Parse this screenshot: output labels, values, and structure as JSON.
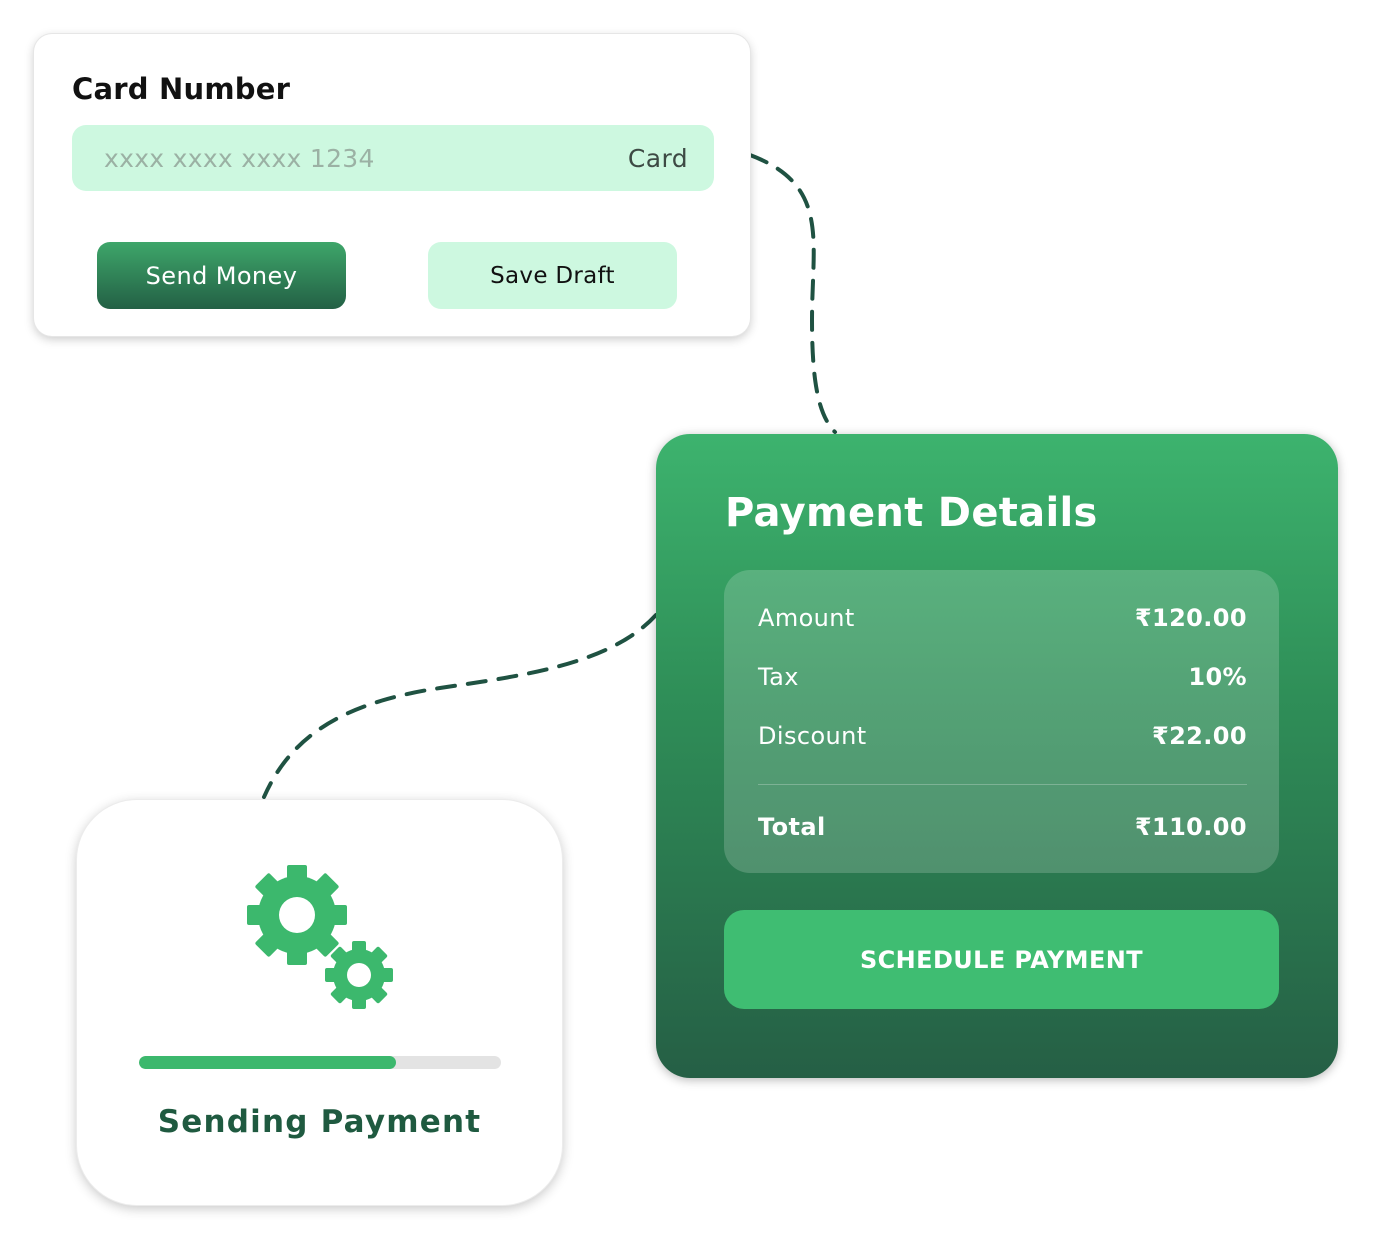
{
  "card_form": {
    "title": "Card Number",
    "input_placeholder": "xxxx xxxx xxxx 1234",
    "input_suffix": "Card",
    "send_button": "Send Money",
    "draft_button": "Save Draft"
  },
  "payment_details": {
    "title": "Payment Details",
    "rows": [
      {
        "label": "Amount",
        "value": "₹120.00"
      },
      {
        "label": "Tax",
        "value": "10%"
      },
      {
        "label": "Discount",
        "value": "₹22.00"
      }
    ],
    "total": {
      "label": "Total",
      "value": "₹110.00"
    },
    "schedule_button": "SCHEDULE PAYMENT"
  },
  "sending_status": {
    "label": "Sending Payment",
    "icon": "gears-icon",
    "progress_percent": 71
  },
  "colors": {
    "accent": "#3cb86d",
    "dark_green": "#1f5a40",
    "mint": "#cdf8e0"
  }
}
